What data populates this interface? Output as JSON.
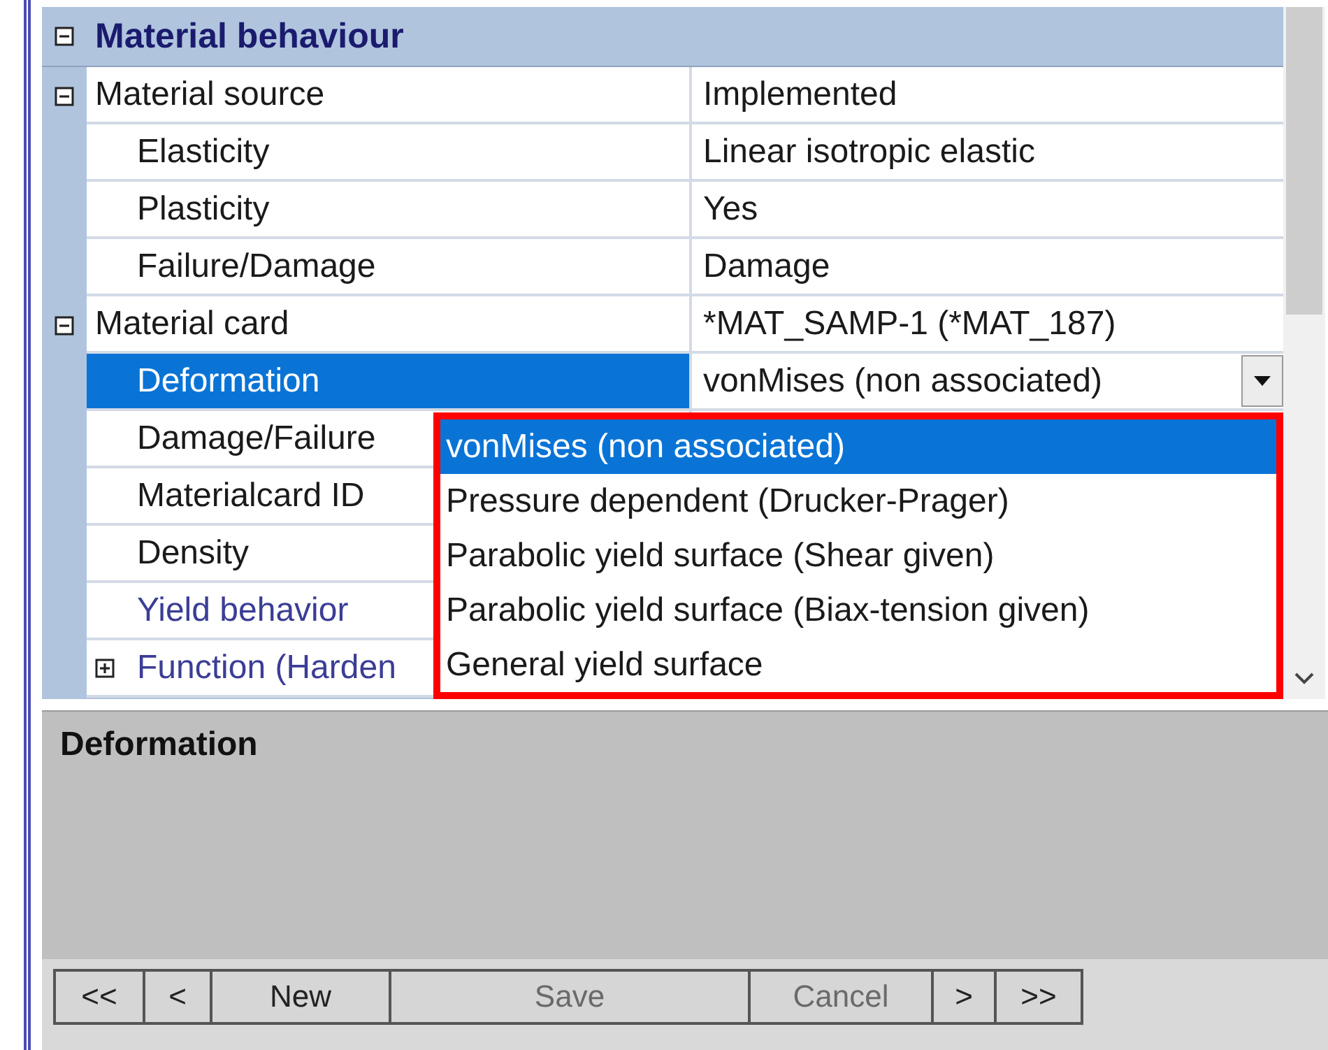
{
  "grid": {
    "category": {
      "title": "Material behaviour",
      "expanded": true
    },
    "rows": [
      {
        "label": "Material source",
        "value": "Implemented",
        "expanded": true,
        "selected": false,
        "emphasis": false,
        "children": [
          {
            "label": "Elasticity",
            "value": "Linear isotropic elastic",
            "selected": false,
            "emphasis": false
          },
          {
            "label": "Plasticity",
            "value": "Yes",
            "selected": false,
            "emphasis": false
          },
          {
            "label": "Failure/Damage",
            "value": "Damage",
            "selected": false,
            "emphasis": false
          }
        ]
      },
      {
        "label": "Material card",
        "value": "*MAT_SAMP-1 (*MAT_187)",
        "expanded": true,
        "selected": false,
        "emphasis": false,
        "children": [
          {
            "label": "Deformation",
            "value": "vonMises (non associated)",
            "kind": "dropdown",
            "selected": true,
            "emphasis": false
          },
          {
            "label": "Damage/Failure",
            "selected": false,
            "emphasis": false
          },
          {
            "label": "Materialcard ID",
            "selected": false,
            "emphasis": false
          },
          {
            "label": "Density",
            "selected": false,
            "emphasis": false
          },
          {
            "label": "Yield behavior",
            "selected": false,
            "emphasis": true
          },
          {
            "label": "Function (Harden",
            "expanded": false,
            "selected": false,
            "emphasis": true
          }
        ]
      }
    ],
    "dropdown_options": [
      {
        "label": "vonMises (non associated)",
        "selected": true
      },
      {
        "label": "Pressure dependent (Drucker-Prager)",
        "selected": false
      },
      {
        "label": "Parabolic yield surface (Shear given)",
        "selected": false
      },
      {
        "label": "Parabolic yield surface (Biax-tension given)",
        "selected": false
      },
      {
        "label": "General yield surface",
        "selected": false
      }
    ]
  },
  "description": {
    "title": "Deformation"
  },
  "buttons": [
    {
      "label": "<<",
      "disabled": false
    },
    {
      "label": "<",
      "disabled": false
    },
    {
      "label": "New",
      "disabled": false
    },
    {
      "label": "Save",
      "disabled": true
    },
    {
      "label": "Cancel",
      "disabled": true
    },
    {
      "label": ">",
      "disabled": false
    },
    {
      "label": ">>",
      "disabled": false
    }
  ]
}
